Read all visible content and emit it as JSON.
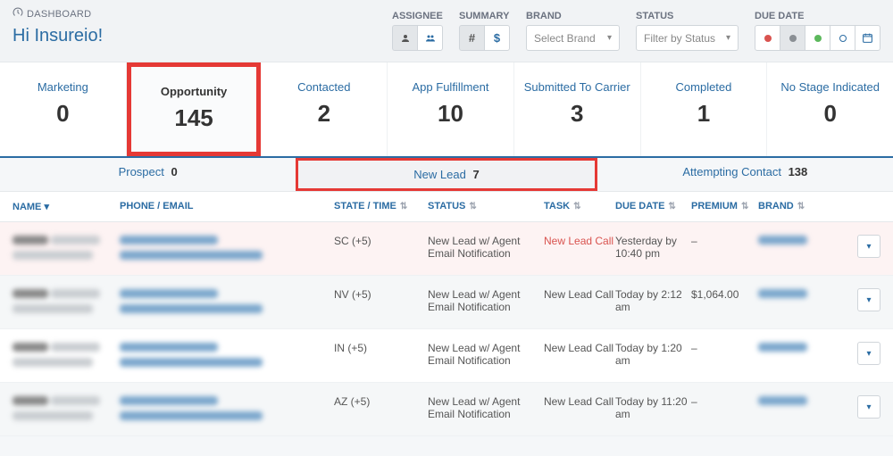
{
  "header": {
    "breadcrumb": "DASHBOARD",
    "greeting": "Hi Insureio!"
  },
  "filters": {
    "assignee_label": "ASSIGNEE",
    "summary_label": "SUMMARY",
    "brand_label": "BRAND",
    "status_label": "STATUS",
    "duedate_label": "DUE DATE",
    "brand_placeholder": "Select Brand",
    "status_placeholder": "Filter by Status"
  },
  "stages": [
    {
      "label": "Marketing",
      "count": "0"
    },
    {
      "label": "Opportunity",
      "count": "145",
      "selected": true
    },
    {
      "label": "Contacted",
      "count": "2"
    },
    {
      "label": "App Fulfillment",
      "count": "10"
    },
    {
      "label": "Submitted To Carrier",
      "count": "3"
    },
    {
      "label": "Completed",
      "count": "1"
    },
    {
      "label": "No Stage Indicated",
      "count": "0"
    }
  ],
  "substages": [
    {
      "label": "Prospect",
      "count": "0"
    },
    {
      "label": "New Lead",
      "count": "7",
      "selected": true
    },
    {
      "label": "Attempting Contact",
      "count": "138"
    }
  ],
  "columns": {
    "name": "NAME",
    "contact": "PHONE / EMAIL",
    "state": "STATE / TIME",
    "status": "STATUS",
    "task": "TASK",
    "due": "DUE DATE",
    "premium": "PREMIUM",
    "brand": "BRAND"
  },
  "rows": [
    {
      "state": "SC (+5)",
      "status": "New Lead w/ Agent Email Notification",
      "task": "New Lead Call",
      "task_red": true,
      "due": "Yesterday by 10:40 pm",
      "premium": "–",
      "bg": "pink"
    },
    {
      "state": "NV (+5)",
      "status": "New Lead w/ Agent Email Notification",
      "task": "New Lead Call",
      "task_red": false,
      "due": "Today by 2:12 am",
      "premium": "$1,064.00",
      "bg": "gray"
    },
    {
      "state": "IN (+5)",
      "status": "New Lead w/ Agent Email Notification",
      "task": "New Lead Call",
      "task_red": false,
      "due": "Today by 1:20 am",
      "premium": "–",
      "bg": "white"
    },
    {
      "state": "AZ (+5)",
      "status": "New Lead w/ Agent Email Notification",
      "task": "New Lead Call",
      "task_red": false,
      "due": "Today by 11:20 am",
      "premium": "–",
      "bg": "gray"
    }
  ]
}
